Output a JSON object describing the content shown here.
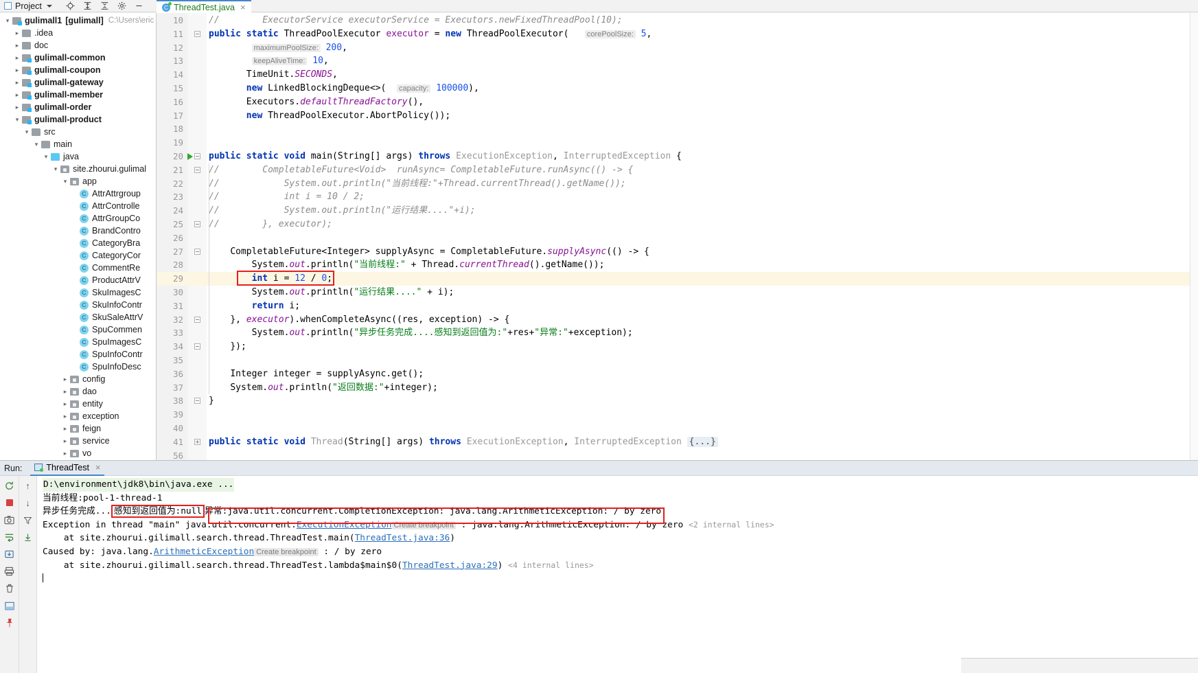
{
  "window": {
    "project_button": "Project",
    "toolbar_icons": [
      "locate-icon",
      "expand-all-icon",
      "collapse-all-icon",
      "settings-icon",
      "hide-icon"
    ]
  },
  "tab": {
    "filename": "ThreadTest.java",
    "close": "×",
    "class_badge": "C"
  },
  "project_tree": [
    {
      "indent": 0,
      "arrow": "v",
      "icon": "module-folder-icon",
      "name": "gulimall1",
      "bracket": "[gulimall]",
      "path": "C:\\Users\\eric",
      "bold": true
    },
    {
      "indent": 1,
      "arrow": ">",
      "icon": "folder-icon",
      "name": ".idea",
      "bold": false
    },
    {
      "indent": 1,
      "arrow": ">",
      "icon": "folder-icon",
      "name": "doc",
      "bold": false
    },
    {
      "indent": 1,
      "arrow": ">",
      "icon": "module-folder-icon",
      "name": "gulimall-common",
      "bold": true
    },
    {
      "indent": 1,
      "arrow": ">",
      "icon": "module-folder-icon",
      "name": "gulimall-coupon",
      "bold": true
    },
    {
      "indent": 1,
      "arrow": ">",
      "icon": "module-folder-icon",
      "name": "gulimall-gateway",
      "bold": true
    },
    {
      "indent": 1,
      "arrow": ">",
      "icon": "module-folder-icon",
      "name": "gulimall-member",
      "bold": true
    },
    {
      "indent": 1,
      "arrow": ">",
      "icon": "module-folder-icon",
      "name": "gulimall-order",
      "bold": true
    },
    {
      "indent": 1,
      "arrow": "v",
      "icon": "module-folder-icon",
      "name": "gulimall-product",
      "bold": true
    },
    {
      "indent": 2,
      "arrow": "v",
      "icon": "folder-icon",
      "name": "src",
      "bold": false
    },
    {
      "indent": 3,
      "arrow": "v",
      "icon": "folder-icon",
      "name": "main",
      "bold": false
    },
    {
      "indent": 4,
      "arrow": "v",
      "icon": "source-folder-icon",
      "name": "java",
      "bold": false
    },
    {
      "indent": 5,
      "arrow": "v",
      "icon": "package-icon",
      "name": "site.zhourui.gulimal",
      "bold": false
    },
    {
      "indent": 6,
      "arrow": "v",
      "icon": "package-icon",
      "name": "app",
      "bold": false
    },
    {
      "indent": 7,
      "arrow": "",
      "icon": "java-class-icon",
      "name": "AttrAttrgroup",
      "bold": false
    },
    {
      "indent": 7,
      "arrow": "",
      "icon": "java-class-icon",
      "name": "AttrControlle",
      "bold": false
    },
    {
      "indent": 7,
      "arrow": "",
      "icon": "java-class-icon",
      "name": "AttrGroupCo",
      "bold": false
    },
    {
      "indent": 7,
      "arrow": "",
      "icon": "java-class-icon",
      "name": "BrandContro",
      "bold": false
    },
    {
      "indent": 7,
      "arrow": "",
      "icon": "java-class-icon",
      "name": "CategoryBra",
      "bold": false
    },
    {
      "indent": 7,
      "arrow": "",
      "icon": "java-class-icon",
      "name": "CategoryCor",
      "bold": false
    },
    {
      "indent": 7,
      "arrow": "",
      "icon": "java-class-icon",
      "name": "CommentRe",
      "bold": false
    },
    {
      "indent": 7,
      "arrow": "",
      "icon": "java-class-icon",
      "name": "ProductAttrV",
      "bold": false
    },
    {
      "indent": 7,
      "arrow": "",
      "icon": "java-class-icon",
      "name": "SkuImagesC",
      "bold": false
    },
    {
      "indent": 7,
      "arrow": "",
      "icon": "java-class-icon",
      "name": "SkuInfoContr",
      "bold": false
    },
    {
      "indent": 7,
      "arrow": "",
      "icon": "java-class-icon",
      "name": "SkuSaleAttrV",
      "bold": false
    },
    {
      "indent": 7,
      "arrow": "",
      "icon": "java-class-icon",
      "name": "SpuCommen",
      "bold": false
    },
    {
      "indent": 7,
      "arrow": "",
      "icon": "java-class-icon",
      "name": "SpuImagesC",
      "bold": false
    },
    {
      "indent": 7,
      "arrow": "",
      "icon": "java-class-icon",
      "name": "SpuInfoContr",
      "bold": false
    },
    {
      "indent": 7,
      "arrow": "",
      "icon": "java-class-icon",
      "name": "SpuInfoDesc",
      "bold": false
    },
    {
      "indent": 6,
      "arrow": ">",
      "icon": "package-icon",
      "name": "config",
      "bold": false
    },
    {
      "indent": 6,
      "arrow": ">",
      "icon": "package-icon",
      "name": "dao",
      "bold": false
    },
    {
      "indent": 6,
      "arrow": ">",
      "icon": "package-icon",
      "name": "entity",
      "bold": false
    },
    {
      "indent": 6,
      "arrow": ">",
      "icon": "package-icon",
      "name": "exception",
      "bold": false
    },
    {
      "indent": 6,
      "arrow": ">",
      "icon": "package-icon",
      "name": "feign",
      "bold": false
    },
    {
      "indent": 6,
      "arrow": ">",
      "icon": "package-icon",
      "name": "service",
      "bold": false
    },
    {
      "indent": 6,
      "arrow": ">",
      "icon": "package-icon",
      "name": "vo",
      "bold": false
    }
  ],
  "editor": {
    "line_numbers": [
      10,
      11,
      12,
      13,
      14,
      15,
      16,
      17,
      18,
      19,
      20,
      21,
      22,
      23,
      24,
      25,
      26,
      27,
      28,
      29,
      30,
      31,
      32,
      33,
      34,
      35,
      36,
      37,
      38,
      39,
      40,
      41,
      56
    ],
    "highlighted_line": 29,
    "red_box_line": 29,
    "code_lines": {
      "10": "//        ExecutorService executorService = Executors.newFixedThreadPool(10);",
      "11_a": "public static ThreadPoolExecutor executor = new ThreadPoolExecutor(",
      "11_hint": "corePoolSize:",
      "11_val": "5,",
      "12_hint": "maximumPoolSize:",
      "12_val": "200,",
      "13_hint": "keepAliveTime:",
      "13_val": "10,",
      "14": "TimeUnit.SECONDS,",
      "15_a": "new LinkedBlockingDeque<>(",
      "15_hint": "capacity:",
      "15_val": "100000),",
      "16": "Executors.defaultThreadFactory(),",
      "17": "new ThreadPoolExecutor.AbortPolicy());",
      "20": "public static void main(String[] args) throws ExecutionException, InterruptedException {",
      "21": "//        CompletableFuture<Void>  runAsync= CompletableFuture.runAsync(() -> {",
      "22": "//            System.out.println(\"当前线程:\"+Thread.currentThread().getName());",
      "23": "//            int i = 10 / 2;",
      "24": "//            System.out.println(\"运行结果....\"+i);",
      "25": "//        }, executor);",
      "27": "CompletableFuture<Integer> supplyAsync = CompletableFuture.supplyAsync(() -> {",
      "28": "System.out.println(\"当前线程:\" + Thread.currentThread().getName());",
      "29": "int i = 12 / 0;",
      "30": "System.out.println(\"运行结果....\" + i);",
      "31": "return i;",
      "32": "}, executor).whenCompleteAsync((res, exception) -> {",
      "33": "System.out.println(\"异步任务完成....感知到返回值为:\"+res+\"异常:\"+exception);",
      "34": "});",
      "36": "Integer integer = supplyAsync.get();",
      "37": "System.out.println(\"返回数据:\"+integer);",
      "38": "}",
      "41": "public static void Thread(String[] args) throws ExecutionException, InterruptedException {...}"
    }
  },
  "run_panel": {
    "label": "Run:",
    "tab_name": "ThreadTest",
    "tab_close": "×",
    "left_toolbar_icons": [
      "rerun-icon",
      "stop-icon",
      "camera-icon",
      "print-icon",
      "soft-wrap-icon",
      "scroll-to-end-icon",
      "export-icon",
      "trash-icon",
      "layout-icon",
      "pin-icon"
    ],
    "console_lines": [
      {
        "id": "cmd",
        "text": "D:\\environment\\jdk8\\bin\\java.exe ...",
        "style": "green-bg"
      },
      {
        "id": "thread",
        "text": "当前线程:pool-1-thread-1",
        "style": "plain"
      },
      {
        "id": "async",
        "prefix": "异步任务完成...",
        "boxed": "感知到返回值为:null",
        "mid": "异常",
        "rest": ":java.util.concurrent.CompletionException: java.lang.ArithmeticException: / by zero",
        "style": "boxed"
      },
      {
        "id": "exc_main",
        "a": "Exception in thread \"main\" java.util.concurrent.",
        "link": "ExecutionException",
        "chip": "Create breakpoint",
        "b": " : java.lang.ArithmeticException: / by zero ",
        "tag": "<2 internal lines>",
        "style": "exception"
      },
      {
        "id": "at_main",
        "a": "    at site.zhourui.gilimall.search.thread.ThreadTest.main(",
        "link": "ThreadTest.java:36",
        "b": ")",
        "style": "trace"
      },
      {
        "id": "caused",
        "a": "Caused by: java.lang.",
        "link": "ArithmeticException",
        "chip": "Create breakpoint",
        "b": " : / by zero",
        "style": "exception"
      },
      {
        "id": "at_lambda",
        "a": "    at site.zhourui.gilimall.search.thread.ThreadTest.lambda$main$0(",
        "link": "ThreadTest.java:29",
        "b": ") ",
        "tag": "<4 internal lines>",
        "style": "trace"
      }
    ]
  },
  "colors": {
    "accent": "#4387c7",
    "error_box": "#e02020",
    "highlight_row": "#fdf6e3",
    "string": "#067d17",
    "keyword": "#0033b3",
    "number": "#1750eb",
    "comment": "#8c8c8c",
    "console_green_bg": "#e9f5e4"
  }
}
